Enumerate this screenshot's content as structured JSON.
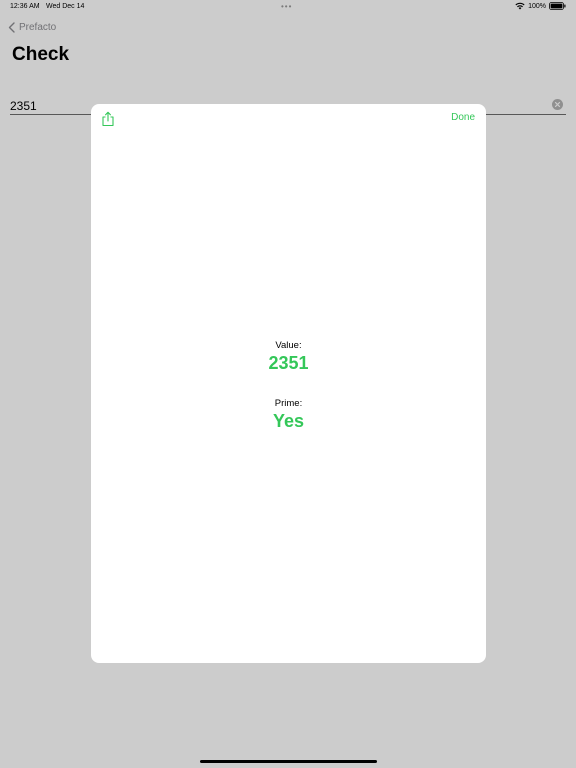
{
  "status_bar": {
    "time": "12:36 AM",
    "date": "Wed Dec 14",
    "battery_text": "100%",
    "icons": [
      "wifi-icon",
      "battery-icon"
    ]
  },
  "nav": {
    "back_label": "Prefacto",
    "title": "Check"
  },
  "input": {
    "value": "2351"
  },
  "sheet": {
    "done_label": "Done",
    "share_icon": "share-icon",
    "value_label": "Value:",
    "value": "2351",
    "prime_label": "Prime:",
    "prime_value": "Yes"
  },
  "colors": {
    "accent": "#34c759",
    "secondary_text": "#8e8e93",
    "overlay": "rgba(0,0,0,0.2)"
  }
}
